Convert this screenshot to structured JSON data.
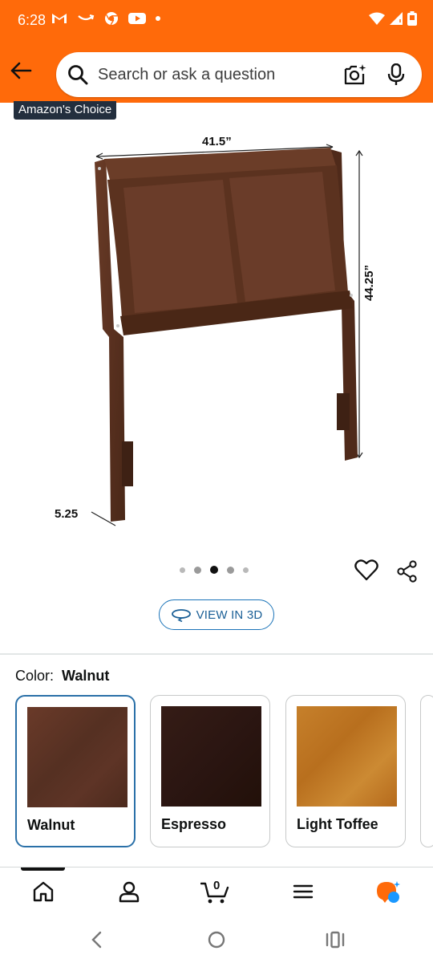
{
  "status_bar": {
    "time": "6:28"
  },
  "search": {
    "placeholder": "Search or ask a question"
  },
  "badge": "Amazon's Choice",
  "dimensions": {
    "width": "41.5”",
    "height": "44.25”",
    "depth": "5.25"
  },
  "carousel": {
    "count": 5,
    "active_index": 2
  },
  "view3d_label": "VIEW IN 3D",
  "color_section": {
    "label": "Color:",
    "selected": "Walnut",
    "options": [
      {
        "name": "Walnut",
        "swatch": "#5b3224"
      },
      {
        "name": "Espresso",
        "swatch": "#2d1712"
      },
      {
        "name": "Light Toffee",
        "swatch": "#c07a25"
      }
    ]
  },
  "bottom_nav": {
    "items": [
      "home-icon",
      "account-icon",
      "cart-icon",
      "menu-icon",
      "rufus-icon"
    ],
    "cart_count": "0"
  },
  "colors": {
    "accent": "#ff6a0a",
    "link": "#1a73b8",
    "wood": "#5a3322"
  }
}
